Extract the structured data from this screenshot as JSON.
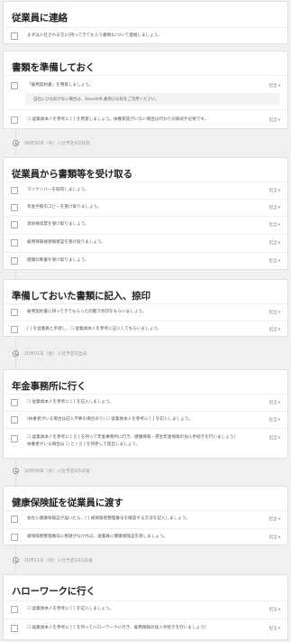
{
  "sections": [
    {
      "title": "従業員に連絡",
      "tasks": [
        {
          "text": "まずは入社される方に[持ってきてもらう書類]について連絡しましょう。",
          "assign": ""
        }
      ]
    },
    {
      "title": "書類を準備しておく",
      "tasks": [
        {
          "text": "「雇用契約書」を用意しましょう。",
          "assign": "担当 ▾"
        },
        {
          "text": "☐ 従業員本人を参考に [ ] を用意しましょう。扶養家族がいない場合は代わりの様式が必要です。",
          "assign": "担当 ▾"
        }
      ],
      "note": "自社にひな形がない場合は、SmartHR 雇用ひな形をご活用ください。"
    },
    {
      "milestone": "09月30日（木）入社予定日3日前",
      "title": "従業員から書類等を受け取る",
      "tasks": [
        {
          "text": "マイナンバーを取得しましょう。",
          "assign": "担当 ▾"
        },
        {
          "text": "年金手帳のコピーを受け取りましょう。",
          "assign": "担当 ▾"
        },
        {
          "text": "源泉徴収票を受け取りましょう。",
          "assign": "担当 ▾"
        },
        {
          "text": "雇用保険被保険者証を受け取りましょう。",
          "assign": "担当 ▾"
        },
        {
          "text": "健康診断書を受け取りましょう。",
          "assign": "担当 ▾"
        }
      ]
    },
    {
      "title": "準備しておいた書類に記入、捺印",
      "tasks": [
        {
          "text": "雇用契約書に持ってきてもらった印鑑で捺印をもらいましょう。",
          "assign": "担当 ▾"
        },
        {
          "text": "[ ] を従業員と手渡し、☐ 従業員本人を参考に記入してもらいましょう。",
          "assign": "担当 ▾"
        }
      ]
    },
    {
      "milestone": "10月01日（金）入社予定日当日",
      "title": "年金事務所に行く",
      "tasks": [
        {
          "text": "☐ 従業員本人を参考に [ ] を記入しましょう。",
          "assign": "担当 ▾"
        },
        {
          "text": "(扶養者がいる場合は記入不要の場合あり) ☐ 従業員本人を参考に [ ] を記入しましょう。",
          "assign": "担当 ▾"
        },
        {
          "text": "☐ 従業員本人を参考に [ ][ ] を持って年金事務所に行き、健康保険・厚生年金保険の加入手続きを行いましょう！",
          "assign": "担当 ▾"
        }
      ],
      "extra": "扶養者がいる場合は ☐ と [ ][ ] を持参して提出しましょう。"
    },
    {
      "milestone": "10月06日（水）入社予定日5日後",
      "title": "健康保険証を従業員に渡す",
      "tasks": [
        {
          "text": "会社に健康保険証が届いたら、[ ] 被保険者整理番号を確認する方法を記入しましょう。",
          "assign": "担当 ▾"
        },
        {
          "text": "被保険者整理番号に相違がなければ、従業員に健康保険証を渡しましょう。",
          "assign": "担当 ▾"
        }
      ]
    },
    {
      "milestone": "10月11日（月）入社予定日10日後",
      "title": "ハローワークに行く",
      "tasks": [
        {
          "text": "☐ 従業員本人を参考に [ ] を記入しましょう。",
          "assign": "担当 ▾"
        },
        {
          "text": "☐ 従業員本人を参考に [ ] を持ってハローワークに行き、雇用保険の加入手続きを行いましょう！",
          "assign": "担当 ▾"
        }
      ]
    }
  ]
}
